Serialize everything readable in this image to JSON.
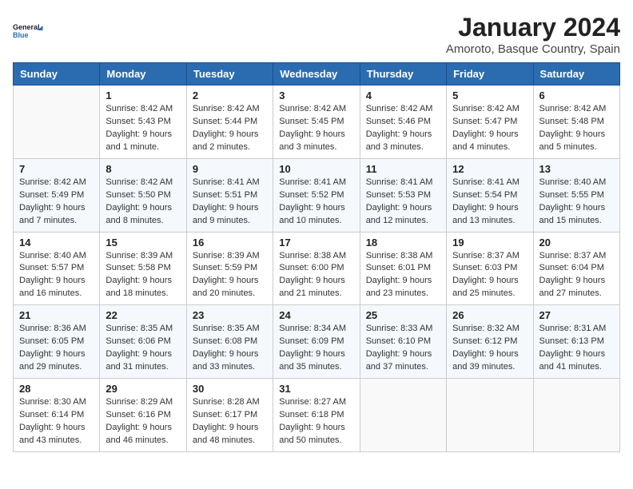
{
  "logo": {
    "line1": "General",
    "line2": "Blue"
  },
  "title": "January 2024",
  "subtitle": "Amoroto, Basque Country, Spain",
  "header_color": "#2b6cb0",
  "days_of_week": [
    "Sunday",
    "Monday",
    "Tuesday",
    "Wednesday",
    "Thursday",
    "Friday",
    "Saturday"
  ],
  "weeks": [
    [
      {
        "day": "",
        "detail": ""
      },
      {
        "day": "1",
        "detail": "Sunrise: 8:42 AM\nSunset: 5:43 PM\nDaylight: 9 hours\nand 1 minute."
      },
      {
        "day": "2",
        "detail": "Sunrise: 8:42 AM\nSunset: 5:44 PM\nDaylight: 9 hours\nand 2 minutes."
      },
      {
        "day": "3",
        "detail": "Sunrise: 8:42 AM\nSunset: 5:45 PM\nDaylight: 9 hours\nand 3 minutes."
      },
      {
        "day": "4",
        "detail": "Sunrise: 8:42 AM\nSunset: 5:46 PM\nDaylight: 9 hours\nand 3 minutes."
      },
      {
        "day": "5",
        "detail": "Sunrise: 8:42 AM\nSunset: 5:47 PM\nDaylight: 9 hours\nand 4 minutes."
      },
      {
        "day": "6",
        "detail": "Sunrise: 8:42 AM\nSunset: 5:48 PM\nDaylight: 9 hours\nand 5 minutes."
      }
    ],
    [
      {
        "day": "7",
        "detail": "Sunrise: 8:42 AM\nSunset: 5:49 PM\nDaylight: 9 hours\nand 7 minutes."
      },
      {
        "day": "8",
        "detail": "Sunrise: 8:42 AM\nSunset: 5:50 PM\nDaylight: 9 hours\nand 8 minutes."
      },
      {
        "day": "9",
        "detail": "Sunrise: 8:41 AM\nSunset: 5:51 PM\nDaylight: 9 hours\nand 9 minutes."
      },
      {
        "day": "10",
        "detail": "Sunrise: 8:41 AM\nSunset: 5:52 PM\nDaylight: 9 hours\nand 10 minutes."
      },
      {
        "day": "11",
        "detail": "Sunrise: 8:41 AM\nSunset: 5:53 PM\nDaylight: 9 hours\nand 12 minutes."
      },
      {
        "day": "12",
        "detail": "Sunrise: 8:41 AM\nSunset: 5:54 PM\nDaylight: 9 hours\nand 13 minutes."
      },
      {
        "day": "13",
        "detail": "Sunrise: 8:40 AM\nSunset: 5:55 PM\nDaylight: 9 hours\nand 15 minutes."
      }
    ],
    [
      {
        "day": "14",
        "detail": "Sunrise: 8:40 AM\nSunset: 5:57 PM\nDaylight: 9 hours\nand 16 minutes."
      },
      {
        "day": "15",
        "detail": "Sunrise: 8:39 AM\nSunset: 5:58 PM\nDaylight: 9 hours\nand 18 minutes."
      },
      {
        "day": "16",
        "detail": "Sunrise: 8:39 AM\nSunset: 5:59 PM\nDaylight: 9 hours\nand 20 minutes."
      },
      {
        "day": "17",
        "detail": "Sunrise: 8:38 AM\nSunset: 6:00 PM\nDaylight: 9 hours\nand 21 minutes."
      },
      {
        "day": "18",
        "detail": "Sunrise: 8:38 AM\nSunset: 6:01 PM\nDaylight: 9 hours\nand 23 minutes."
      },
      {
        "day": "19",
        "detail": "Sunrise: 8:37 AM\nSunset: 6:03 PM\nDaylight: 9 hours\nand 25 minutes."
      },
      {
        "day": "20",
        "detail": "Sunrise: 8:37 AM\nSunset: 6:04 PM\nDaylight: 9 hours\nand 27 minutes."
      }
    ],
    [
      {
        "day": "21",
        "detail": "Sunrise: 8:36 AM\nSunset: 6:05 PM\nDaylight: 9 hours\nand 29 minutes."
      },
      {
        "day": "22",
        "detail": "Sunrise: 8:35 AM\nSunset: 6:06 PM\nDaylight: 9 hours\nand 31 minutes."
      },
      {
        "day": "23",
        "detail": "Sunrise: 8:35 AM\nSunset: 6:08 PM\nDaylight: 9 hours\nand 33 minutes."
      },
      {
        "day": "24",
        "detail": "Sunrise: 8:34 AM\nSunset: 6:09 PM\nDaylight: 9 hours\nand 35 minutes."
      },
      {
        "day": "25",
        "detail": "Sunrise: 8:33 AM\nSunset: 6:10 PM\nDaylight: 9 hours\nand 37 minutes."
      },
      {
        "day": "26",
        "detail": "Sunrise: 8:32 AM\nSunset: 6:12 PM\nDaylight: 9 hours\nand 39 minutes."
      },
      {
        "day": "27",
        "detail": "Sunrise: 8:31 AM\nSunset: 6:13 PM\nDaylight: 9 hours\nand 41 minutes."
      }
    ],
    [
      {
        "day": "28",
        "detail": "Sunrise: 8:30 AM\nSunset: 6:14 PM\nDaylight: 9 hours\nand 43 minutes."
      },
      {
        "day": "29",
        "detail": "Sunrise: 8:29 AM\nSunset: 6:16 PM\nDaylight: 9 hours\nand 46 minutes."
      },
      {
        "day": "30",
        "detail": "Sunrise: 8:28 AM\nSunset: 6:17 PM\nDaylight: 9 hours\nand 48 minutes."
      },
      {
        "day": "31",
        "detail": "Sunrise: 8:27 AM\nSunset: 6:18 PM\nDaylight: 9 hours\nand 50 minutes."
      },
      {
        "day": "",
        "detail": ""
      },
      {
        "day": "",
        "detail": ""
      },
      {
        "day": "",
        "detail": ""
      }
    ]
  ]
}
